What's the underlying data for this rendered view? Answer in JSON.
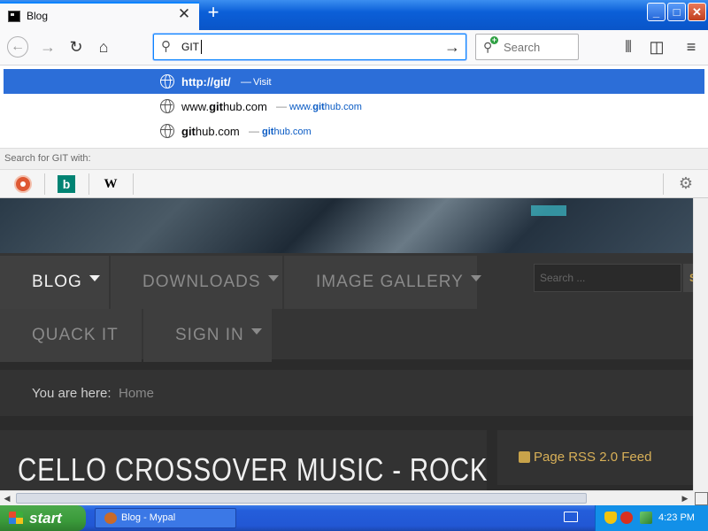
{
  "browser": {
    "tab_title": "Blog",
    "tab_close": "✕",
    "new_tab": "+",
    "window_buttons": {
      "minimize": "_",
      "maximize": "□",
      "close": "✕"
    },
    "url_value": "GIT",
    "search_placeholder": "Search"
  },
  "autocomplete": {
    "rows": [
      {
        "title_bold": "http://git/",
        "sep": "—",
        "action": "Visit"
      },
      {
        "title_pre": "www.",
        "title_bold": "git",
        "title_post": "hub.com",
        "sep": "—",
        "url_pre": "www.",
        "url_bold": "git",
        "url_post": "hub.com"
      },
      {
        "title_pre": "",
        "title_bold": "git",
        "title_post": "hub.com",
        "sep": "—",
        "url_pre": "",
        "url_bold": "git",
        "url_post": "hub.com"
      }
    ],
    "search_with_label": "Search for GIT with:",
    "engines": [
      {
        "name": "duckduckgo-icon"
      },
      {
        "name": "bing-icon",
        "glyph": "b"
      },
      {
        "name": "wikipedia-icon",
        "glyph": "W"
      }
    ]
  },
  "site": {
    "menu": [
      "BLOG",
      "DOWNLOADS",
      "IMAGE GALLERY",
      "QUACK IT",
      "SIGN IN"
    ],
    "search_placeholder": "Search ...",
    "search_button": "S",
    "breadcrumb_label": "You are here:",
    "breadcrumb_home": "Home",
    "article_title": "CELLO CROSSOVER MUSIC - ROCK",
    "rss_label": "Page RSS 2.0 Feed"
  },
  "taskbar": {
    "start_label": "start",
    "task_label": "Blog - Mypal",
    "clock": "4:23 PM"
  },
  "colors": {
    "tab_accent": "#0a84ff",
    "autocomplete_selected": "#2c6ed8",
    "site_gold": "#d8b058",
    "xp_blue": "#245edb",
    "xp_green": "#3a9a3a"
  }
}
